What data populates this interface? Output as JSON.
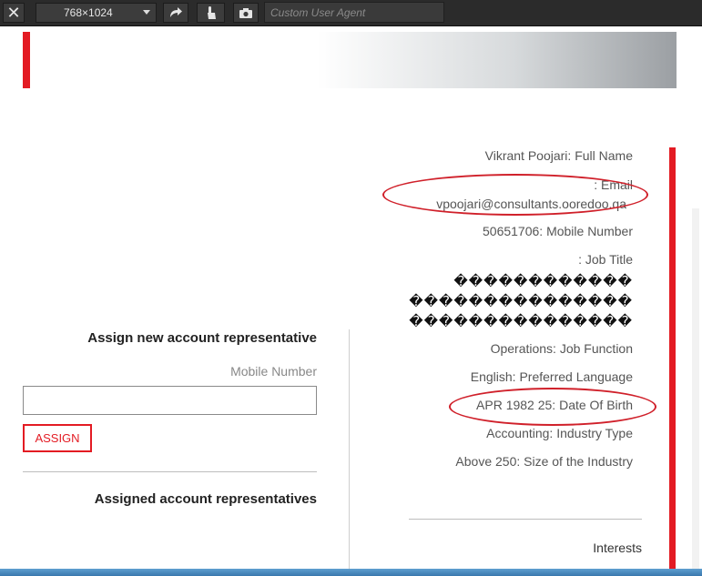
{
  "toolbar": {
    "size_label": "768×1024",
    "ua_placeholder": "Custom User Agent"
  },
  "assign": {
    "title": "Assign new account representative",
    "mobile_label": "Mobile Number",
    "button_label": "ASSIGN",
    "assigned_title": "Assigned account representatives"
  },
  "profile": {
    "full_name": "Vikrant Poojari: Full Name",
    "email_label": ": Email",
    "email_value": "vpoojari@consultants.ooredoo.qa",
    "mobile": "50651706: Mobile Number",
    "job_title": ": Job Title",
    "garbled_1": "������������",
    "garbled_2": "���������������",
    "garbled_3": "���������������",
    "job_function": "Operations: Job Function",
    "language": "English: Preferred Language",
    "dob": "APR 1982 25: Date Of Birth",
    "industry": "Accounting: Industry Type",
    "industry_size": "Above 250: Size of the Industry",
    "interests": "Interests"
  },
  "colors": {
    "accent_red": "#e31b23",
    "annotation_red": "#d0202a"
  },
  "icons": [
    "close-icon",
    "chevron-down-icon",
    "rotate-icon",
    "touch-icon",
    "camera-icon"
  ]
}
